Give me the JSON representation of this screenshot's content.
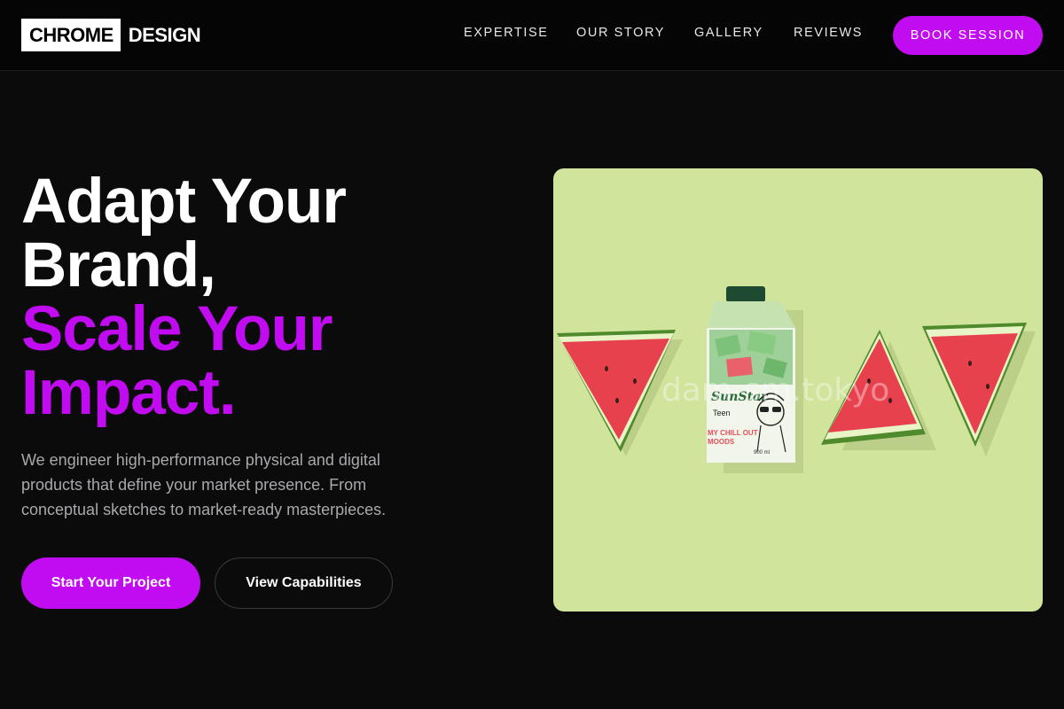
{
  "header": {
    "logo_box": "CHROME",
    "logo_text": "DESIGN",
    "nav": [
      "EXPERTISE",
      "OUR STORY",
      "GALLERY",
      "REVIEWS"
    ],
    "cta": "BOOK SESSION"
  },
  "hero": {
    "title_line1": "Adapt Your",
    "title_line2": "Brand,",
    "title_line3": "Scale Your",
    "title_line4": "Impact.",
    "subtitle": "We engineer high-performance physical and digital products that define your market presence. From conceptual sketches to market-ready masterpieces.",
    "primary_button": "Start Your Project",
    "secondary_button": "View Capabilities"
  },
  "image": {
    "carton_brand": "SunStar",
    "carton_sub": "Teen",
    "carton_tagline_1": "MY CHILL OUT",
    "carton_tagline_2": "MOODS",
    "carton_volume": "900 ml",
    "watermark": "dam-sm.tokyo"
  },
  "colors": {
    "accent": "#c10bf0",
    "background": "#0b0b0c",
    "image_background": "#d0e49b",
    "watermelon_flesh": "#e8414e",
    "watermelon_rind": "#4f8a2c"
  }
}
